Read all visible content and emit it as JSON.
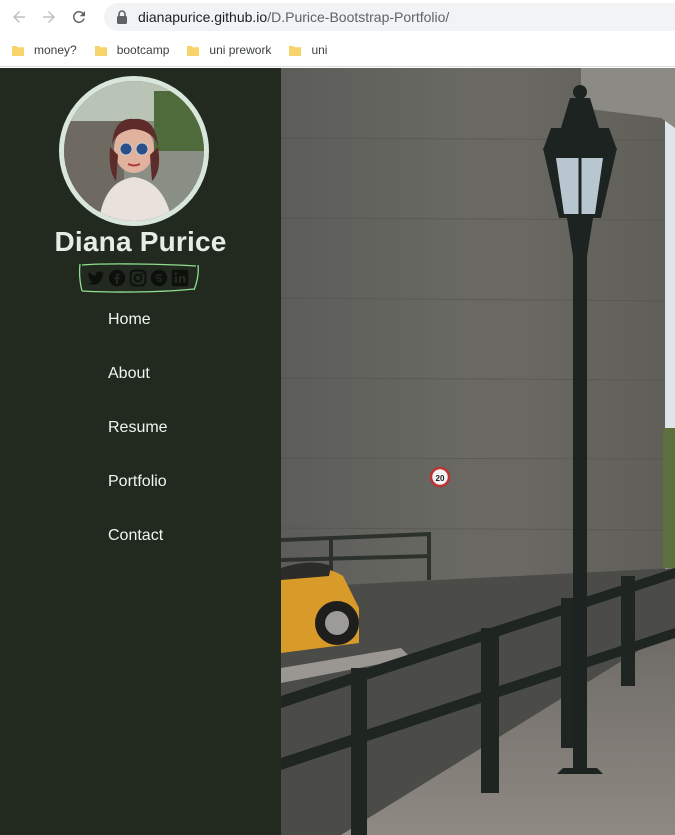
{
  "browser": {
    "url_host": "dianapurice.github.io",
    "url_path": "/D.Purice-Bootstrap-Portfolio/",
    "icons": [
      "back-arrow-icon",
      "forward-arrow-icon",
      "reload-icon",
      "lock-icon"
    ]
  },
  "bookmarks": [
    {
      "label": "money?"
    },
    {
      "label": "bootcamp"
    },
    {
      "label": "uni prework"
    },
    {
      "label": "uni"
    }
  ],
  "profile": {
    "name": "Diana Purice",
    "social": [
      "twitter-icon",
      "facebook-icon",
      "instagram-icon",
      "skype-icon",
      "linkedin-icon"
    ]
  },
  "nav": [
    {
      "label": "Home"
    },
    {
      "label": "About"
    },
    {
      "label": "Resume"
    },
    {
      "label": "Portfolio"
    },
    {
      "label": "Contact"
    }
  ],
  "hero": {
    "speed_sign": "20"
  },
  "colors": {
    "sidebar_bg": "#222a20",
    "scribble": "#8ee08e",
    "bookmark_folder": "#f7d36b"
  }
}
